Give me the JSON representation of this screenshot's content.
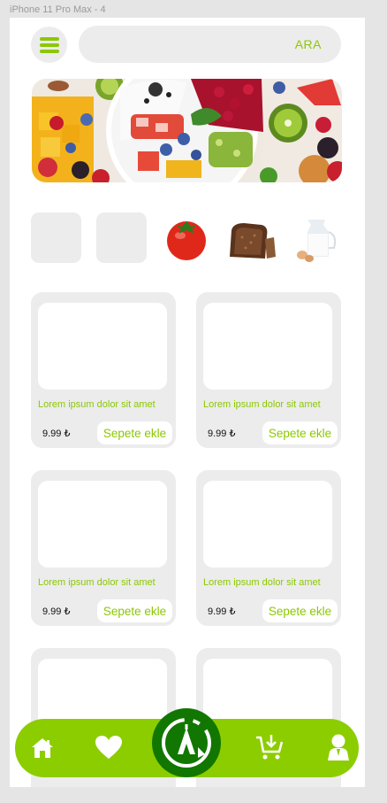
{
  "frame": {
    "label": "iPhone 11 Pro Max - 4"
  },
  "header": {
    "search_label": "ARA",
    "menu_icon": "hamburger-menu-icon"
  },
  "banner": {
    "image": "fruit-bowl-photo"
  },
  "categories": [
    {
      "name": "empty-category"
    },
    {
      "name": "empty-category"
    },
    {
      "name": "tomato-image"
    },
    {
      "name": "bread-image"
    },
    {
      "name": "milk-eggs-image"
    }
  ],
  "products": [
    {
      "title": "Lorem ipsum dolor sit amet",
      "price": "9.99 ₺",
      "button": "Sepete ekle"
    },
    {
      "title": "Lorem ipsum dolor sit amet",
      "price": "9.99 ₺",
      "button": "Sepete ekle"
    },
    {
      "title": "Lorem ipsum dolor sit amet",
      "price": "9.99 ₺",
      "button": "Sepete ekle"
    },
    {
      "title": "Lorem ipsum dolor sit amet",
      "price": "9.99 ₺",
      "button": "Sepete ekle"
    },
    {
      "title": "",
      "price": "",
      "button": ""
    },
    {
      "title": "",
      "price": "",
      "button": ""
    }
  ],
  "tabbar": {
    "icons": [
      "home-icon",
      "heart-icon",
      "fast-delivery-icon",
      "cart-download-icon",
      "user-icon"
    ]
  },
  "colors": {
    "accent": "#8cc800",
    "tabbar": "#8ccd00",
    "center_button": "#117700",
    "card_bg": "#ececec"
  }
}
